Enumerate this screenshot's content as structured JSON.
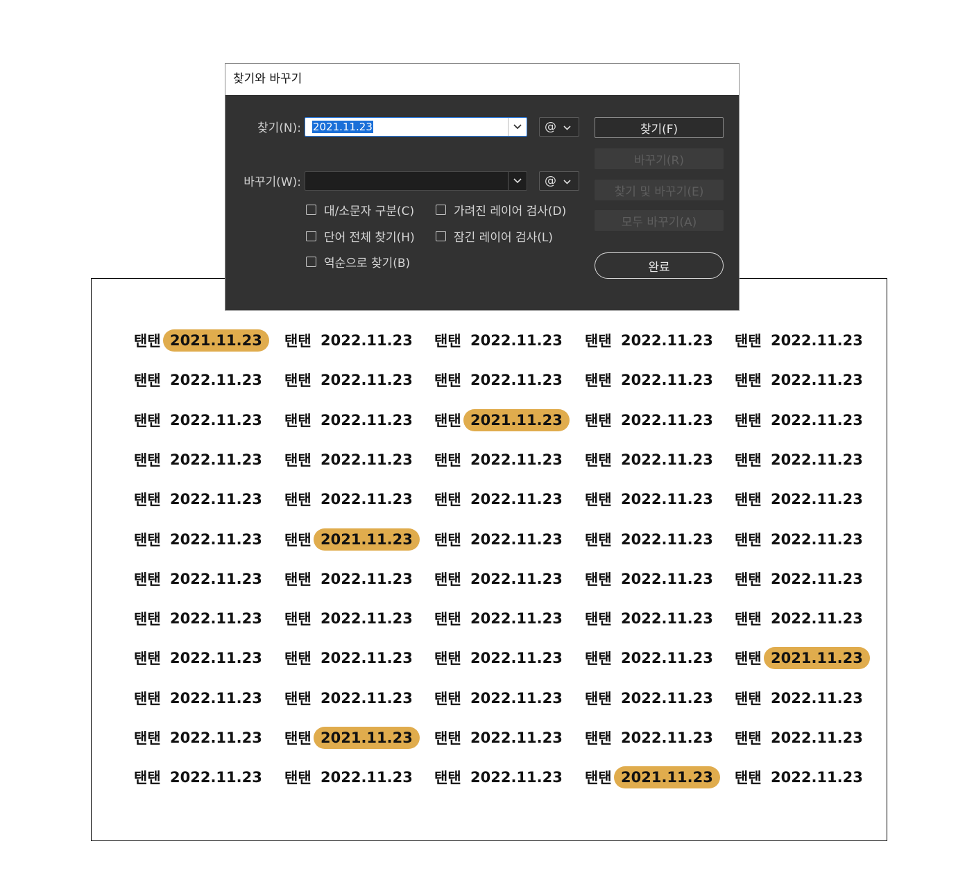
{
  "dialog": {
    "title": "찾기와 바꾸기",
    "find_label": "찾기(N):",
    "find_value": "2021.11.23",
    "replace_label": "바꾸기(W):",
    "replace_value": "",
    "special_char_button": "@",
    "options": [
      {
        "label": "대/소문자 구분(C)",
        "checked": false
      },
      {
        "label": "가려진 레이어 검사(D)",
        "checked": false
      },
      {
        "label": "단어 전체 찾기(H)",
        "checked": false
      },
      {
        "label": "잠긴 레이어 검사(L)",
        "checked": false
      },
      {
        "label": "역순으로 찾기(B)",
        "checked": false
      }
    ],
    "buttons": {
      "find": "찾기(F)",
      "replace": "바꾸기(R)",
      "find_replace": "찾기 및 바꾸기(E)",
      "replace_all": "모두 바꾸기(A)",
      "done": "완료"
    }
  },
  "canvas": {
    "cell_label": "탠탠",
    "default_date": "2022.11.23",
    "match_date": "2021.11.23",
    "highlight_color": "#e0ac4d",
    "columns": 5,
    "rows": 12,
    "matches": [
      [
        0,
        0
      ],
      [
        2,
        2
      ],
      [
        5,
        1
      ],
      [
        8,
        4
      ],
      [
        10,
        1
      ],
      [
        11,
        3
      ]
    ]
  }
}
